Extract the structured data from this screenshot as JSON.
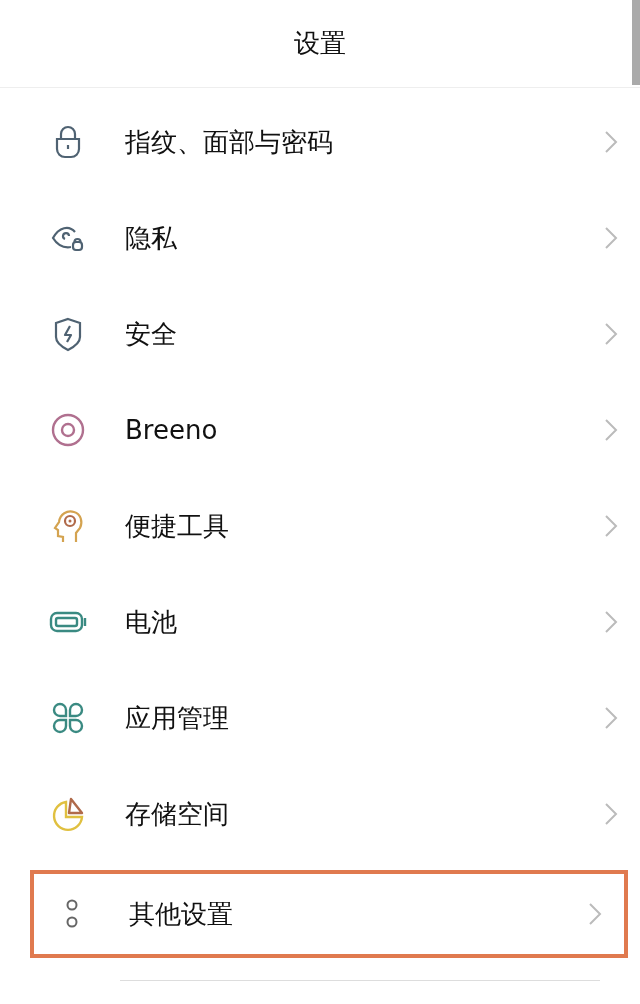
{
  "header": {
    "title": "设置"
  },
  "items": [
    {
      "kind": "lock",
      "label": "指纹、面部与密码",
      "highlighted": false
    },
    {
      "kind": "eye",
      "label": "隐私",
      "highlighted": false
    },
    {
      "kind": "shield",
      "label": "安全",
      "highlighted": false
    },
    {
      "kind": "ring",
      "label": "Breeno",
      "highlighted": false
    },
    {
      "kind": "head",
      "label": "便捷工具",
      "highlighted": false
    },
    {
      "kind": "battery",
      "label": "电池",
      "highlighted": false
    },
    {
      "kind": "apps",
      "label": "应用管理",
      "highlighted": false
    },
    {
      "kind": "pie",
      "label": "存储空间",
      "highlighted": false
    },
    {
      "kind": "dots",
      "label": "其他设置",
      "highlighted": true
    }
  ]
}
